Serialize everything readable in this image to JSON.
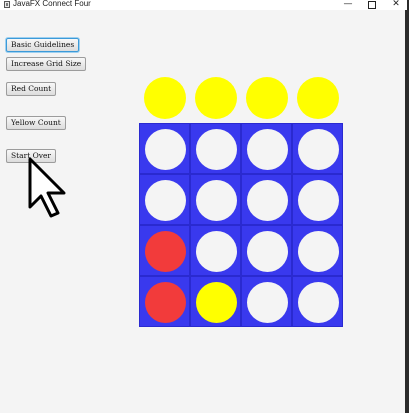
{
  "window": {
    "title": "JavaFX Connect Four",
    "controls": {
      "minimize": "—",
      "maximize": "",
      "close": "✕"
    }
  },
  "buttons": [
    {
      "id": "basic-guidelines",
      "label": "Basic Guidelines",
      "focused": true
    },
    {
      "id": "increase-grid-size",
      "label": "Increase Grid Size",
      "focused": false
    },
    {
      "id": "red-count",
      "label": "Red Count",
      "focused": false
    },
    {
      "id": "yellow-count",
      "label": "Yellow Count",
      "focused": false
    },
    {
      "id": "start-over",
      "label": "Start Over",
      "focused": false
    }
  ],
  "colors": {
    "board": "#3939ee",
    "empty": "#f4f4f4",
    "red": "#f23b3b",
    "yellow": "#ffff00"
  },
  "drop_row": [
    "yellow",
    "yellow",
    "yellow",
    "yellow"
  ],
  "grid": [
    [
      "empty",
      "empty",
      "empty",
      "empty"
    ],
    [
      "empty",
      "empty",
      "empty",
      "empty"
    ],
    [
      "red",
      "empty",
      "empty",
      "empty"
    ],
    [
      "red",
      "yellow",
      "empty",
      "empty"
    ]
  ]
}
